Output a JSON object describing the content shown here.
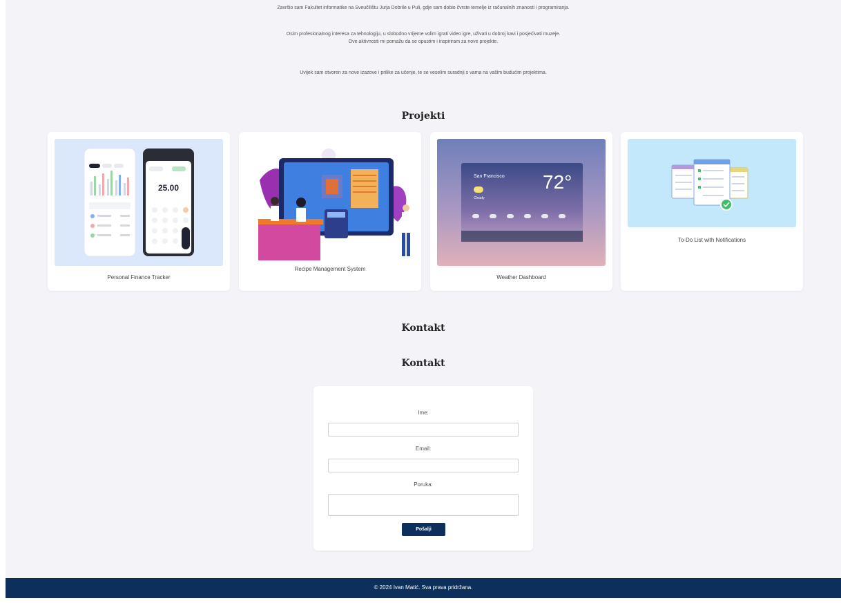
{
  "about": {
    "line1": "Završio sam Fakultet informatike na Sveučilištu Jurja Dobrile u Puli, gdje sam dobio čvrste temelje iz računalnih znanosti i programiranja.",
    "line2": "Osim profesionalnog interesa za tehnologiju, u slobodno vrijeme volim igrati video igre, uživati u dobroj kavi i posjećivati muzeje.",
    "line3": "Ove aktivnosti mi pomažu da se opustim i inspiriram za nove projekte.",
    "line4": "Uvijek sam otvoren za nove izazove i prilike za učenje, te se veselim suradnji s vama na vašim budućim projektima."
  },
  "projects": {
    "title": "Projekti",
    "items": [
      {
        "name": "Personal Finance Tracker",
        "phone_amount": "25.00"
      },
      {
        "name": "Recipe Management System"
      },
      {
        "name": "Weather Dashboard",
        "city": "San Francisco",
        "temp": "72°",
        "condition": "Cloudy"
      },
      {
        "name": "To-Do List with Notifications"
      }
    ]
  },
  "contact": {
    "title1": "Kontakt",
    "title2": "Kontakt",
    "form": {
      "name_label": "Ime:",
      "email_label": "Email:",
      "message_label": "Poruka:",
      "name_value": "",
      "email_value": "",
      "message_value": "",
      "submit_label": "Pošalji"
    }
  },
  "footer": {
    "text": "© 2024 Ivan Matić. Sva prava pridržana."
  },
  "colors": {
    "page_bg": "#f3f3f8",
    "accent": "#0d2f5c",
    "card_bg": "#ffffff"
  }
}
